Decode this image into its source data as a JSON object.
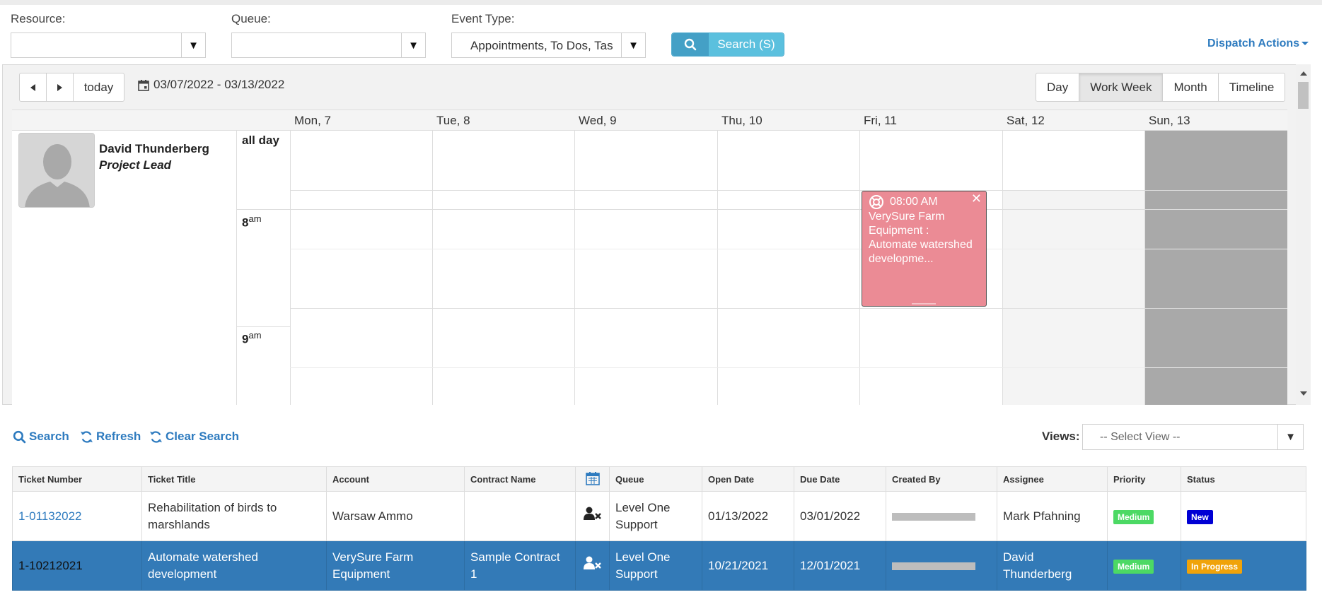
{
  "filters": {
    "resource": {
      "label": "Resource:",
      "value": ""
    },
    "queue": {
      "label": "Queue:",
      "value": ""
    },
    "event_type": {
      "label": "Event Type:",
      "value": "Appointments, To Dos, Tas"
    },
    "search_button": "Search (S)",
    "dispatch_actions": "Dispatch Actions"
  },
  "calendar": {
    "today_label": "today",
    "date_range": "03/07/2022 - 03/13/2022",
    "views": [
      "Day",
      "Work Week",
      "Month",
      "Timeline"
    ],
    "active_view": "Work Week",
    "days": [
      "Mon, 7",
      "Tue, 8",
      "Wed, 9",
      "Thu, 10",
      "Fri, 11",
      "Sat, 12",
      "Sun, 13"
    ],
    "resource": {
      "name": "David Thunderberg",
      "role": "Project Lead"
    },
    "all_day_label": "all day",
    "time_slots": [
      {
        "hour": "8",
        "suffix": "am"
      },
      {
        "hour": "9",
        "suffix": "am"
      }
    ],
    "event": {
      "time": "08:00 AM",
      "title": "VerySure Farm Equipment : Automate watershed developme...",
      "day": "Fri, 11",
      "color": "#eb8b95"
    }
  },
  "toolbar": {
    "search": "Search",
    "refresh": "Refresh",
    "clear_search": "Clear Search",
    "views_label": "Views:",
    "view_select": "-- Select View --"
  },
  "table": {
    "columns": [
      "Ticket Number",
      "Ticket Title",
      "Account",
      "Contract Name",
      "calendar-icon",
      "Queue",
      "Open Date",
      "Due Date",
      "Created By",
      "Assignee",
      "Priority",
      "Status"
    ],
    "rows": [
      {
        "ticket_number": "1-01132022",
        "ticket_title": "Rehabilitation of birds to marshlands",
        "account": "Warsaw Ammo",
        "contract_name": "",
        "queue": "Level One Support",
        "open_date": "01/13/2022",
        "due_date": "03/01/2022",
        "assignee": "Mark Pfahning",
        "priority": "Medium",
        "status": "New",
        "selected": false
      },
      {
        "ticket_number": "1-10212021",
        "ticket_title": "Automate watershed development",
        "account": "VerySure Farm Equipment",
        "contract_name": "Sample Contract 1",
        "queue": "Level One Support",
        "open_date": "10/21/2021",
        "due_date": "12/01/2021",
        "assignee": "David Thunderberg",
        "priority": "Medium",
        "status": "In Progress",
        "selected": true
      }
    ]
  }
}
